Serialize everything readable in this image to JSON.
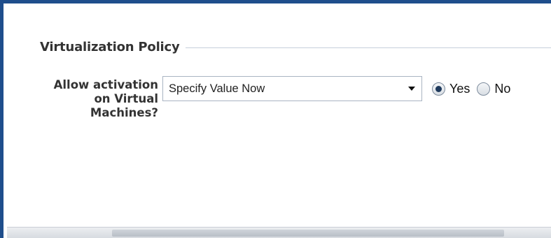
{
  "section": {
    "title": "Virtualization Policy"
  },
  "field": {
    "label": "Allow activation on Virtual Machines?",
    "select_value": "Specify Value Now"
  },
  "radio": {
    "options": [
      {
        "label": "Yes",
        "checked": true
      },
      {
        "label": "No",
        "checked": false
      }
    ]
  },
  "colors": {
    "frame_border": "#1f4e8c",
    "section_rule": "#c7d0db",
    "radio_selected": "#1f3a5c"
  }
}
